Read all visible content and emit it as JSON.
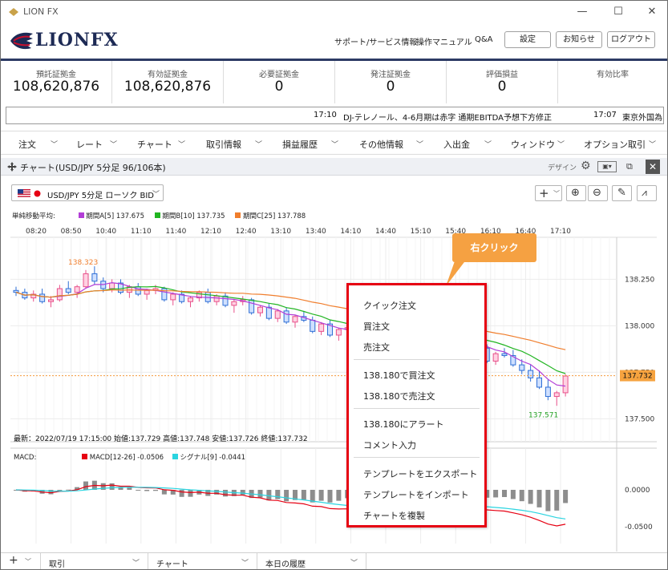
{
  "window": {
    "title": "LION FX",
    "minimize": "—",
    "maximize": "☐",
    "close": "✕"
  },
  "header": {
    "logo": "LIONFX",
    "links": [
      "サポート/サービス情報",
      "操作マニュアル",
      "Q&A"
    ],
    "buttons": [
      "設定",
      "お知らせ",
      "ログアウト"
    ]
  },
  "summary": [
    {
      "label": "預託証拠金",
      "value": "108,620,876"
    },
    {
      "label": "有効証拠金",
      "value": "108,620,876"
    },
    {
      "label": "必要証拠金",
      "value": "0"
    },
    {
      "label": "発注証拠金",
      "value": "0"
    },
    {
      "label": "評価損益",
      "value": "0"
    },
    {
      "label": "有効比率",
      "value": ""
    }
  ],
  "ticker": [
    {
      "time": "17:10",
      "text": "DJ-テレノール、4-6月期は赤字 通期EBITDA予想下方修正"
    },
    {
      "time": "17:07",
      "text": "東京外国為"
    }
  ],
  "menu": [
    "注文",
    "レート",
    "チャート",
    "取引情報",
    "損益履歴",
    "その他情報",
    "入出金",
    "ウィンドウ",
    "オプション取引"
  ],
  "panel": {
    "title": "チャート(USD/JPY 5分足 96/106本)",
    "design": "デザイン"
  },
  "symbol": {
    "label": "USD/JPY 5分足 ローソク BID",
    "flag": "us-flag",
    "dot": "jp-dot"
  },
  "legend": {
    "title": "単純移動平均:",
    "items": [
      {
        "label": "期間A[5] 137.675",
        "color": "#b23dd6"
      },
      {
        "label": "期間B[10] 137.735",
        "color": "#22b522"
      },
      {
        "label": "期間C[25] 137.788",
        "color": "#f07e2d"
      }
    ]
  },
  "status": "最新：2022/07/19 17:15:00 始値:137.729 高値:137.748 安値:137.726 終値:137.732",
  "macd_legend": {
    "title": "MACD:",
    "items": [
      {
        "label": "MACD[12-26] -0.0506",
        "color": "#e60012"
      },
      {
        "label": "シグナル[9] -0.0441",
        "color": "#2ad4e0"
      }
    ]
  },
  "context_menu": {
    "items": [
      "クイック注文",
      "買注文",
      "売注文",
      "138.180で買注文",
      "138.180で売注文",
      "138.180にアラート",
      "コメント入力",
      "テンプレートをエクスポート",
      "テンプレートをインポート",
      "チャートを複製"
    ]
  },
  "callout": "右クリック",
  "bottom_tabs": [
    "取引",
    "チャート",
    "本日の履歴"
  ],
  "chart_data": {
    "type": "candlestick",
    "time_labels": [
      "08:20",
      "08:50",
      "10:40",
      "11:10",
      "11:40",
      "12:10",
      "12:40",
      "13:10",
      "13:40",
      "14:10",
      "14:40",
      "15:10",
      "15:40",
      "16:10",
      "16:40",
      "17:10"
    ],
    "y_ticks": [
      138.25,
      138.0,
      137.75,
      137.5
    ],
    "y_tick_labels": [
      "138.250",
      "138.000",
      "137.750",
      "137.500"
    ],
    "ylim": [
      137.45,
      138.45
    ],
    "current_price": "137.732",
    "high_label": "138.323",
    "low_label": "137.571",
    "candles": [
      [
        138.19,
        138.21,
        138.16,
        138.18
      ],
      [
        138.18,
        138.2,
        138.14,
        138.15
      ],
      [
        138.15,
        138.19,
        138.13,
        138.17
      ],
      [
        138.17,
        138.2,
        138.12,
        138.13
      ],
      [
        138.13,
        138.16,
        138.1,
        138.14
      ],
      [
        138.14,
        138.22,
        138.13,
        138.2
      ],
      [
        138.2,
        138.24,
        138.17,
        138.18
      ],
      [
        138.18,
        138.22,
        138.15,
        138.21
      ],
      [
        138.21,
        138.3,
        138.2,
        138.28
      ],
      [
        138.28,
        138.32,
        138.22,
        138.24
      ],
      [
        138.24,
        138.26,
        138.18,
        138.2
      ],
      [
        138.2,
        138.25,
        138.18,
        138.23
      ],
      [
        138.23,
        138.25,
        138.17,
        138.18
      ],
      [
        138.18,
        138.22,
        138.15,
        138.21
      ],
      [
        138.21,
        138.23,
        138.16,
        138.17
      ],
      [
        138.17,
        138.2,
        138.14,
        138.19
      ],
      [
        138.19,
        138.22,
        138.17,
        138.2
      ],
      [
        138.2,
        138.21,
        138.13,
        138.14
      ],
      [
        138.14,
        138.18,
        138.11,
        138.17
      ],
      [
        138.17,
        138.19,
        138.12,
        138.13
      ],
      [
        138.13,
        138.16,
        138.1,
        138.15
      ],
      [
        138.15,
        138.19,
        138.13,
        138.18
      ],
      [
        138.18,
        138.2,
        138.12,
        138.13
      ],
      [
        138.13,
        138.17,
        138.11,
        138.16
      ],
      [
        138.16,
        138.18,
        138.1,
        138.11
      ],
      [
        138.11,
        138.14,
        138.07,
        138.13
      ],
      [
        138.13,
        138.16,
        138.11,
        138.14
      ],
      [
        138.14,
        138.15,
        138.06,
        138.07
      ],
      [
        138.07,
        138.11,
        138.05,
        138.1
      ],
      [
        138.1,
        138.12,
        138.03,
        138.04
      ],
      [
        138.04,
        138.09,
        138.02,
        138.08
      ],
      [
        138.08,
        138.1,
        138.01,
        138.02
      ],
      [
        138.02,
        138.06,
        137.99,
        138.05
      ],
      [
        138.05,
        138.08,
        138.02,
        138.03
      ],
      [
        138.03,
        138.05,
        137.96,
        137.97
      ],
      [
        137.97,
        138.02,
        137.95,
        138.01
      ],
      [
        138.01,
        138.03,
        137.94,
        137.95
      ],
      [
        137.95,
        137.99,
        137.92,
        137.98
      ],
      [
        137.98,
        138.01,
        137.96,
        137.99
      ],
      [
        137.99,
        138.02,
        137.96,
        137.97
      ],
      [
        137.97,
        138.0,
        137.95,
        137.99
      ],
      [
        137.99,
        138.03,
        137.97,
        138.02
      ],
      [
        138.02,
        138.05,
        137.98,
        137.99
      ],
      [
        137.99,
        138.01,
        137.96,
        138.0
      ],
      [
        138.0,
        138.02,
        137.97,
        137.98
      ],
      [
        137.98,
        138.0,
        137.94,
        137.96
      ],
      [
        137.96,
        138.0,
        137.94,
        137.99
      ],
      [
        137.99,
        138.01,
        137.96,
        137.97
      ],
      [
        137.97,
        137.99,
        137.9,
        137.91
      ],
      [
        137.91,
        137.96,
        137.89,
        137.95
      ],
      [
        137.95,
        137.98,
        137.93,
        137.94
      ],
      [
        137.94,
        137.96,
        137.88,
        137.89
      ],
      [
        137.89,
        137.93,
        137.86,
        137.92
      ],
      [
        137.92,
        137.95,
        137.87,
        137.88
      ],
      [
        137.88,
        137.9,
        137.8,
        137.81
      ],
      [
        137.81,
        137.86,
        137.79,
        137.85
      ],
      [
        137.85,
        137.88,
        137.83,
        137.84
      ],
      [
        137.84,
        137.87,
        137.78,
        137.79
      ],
      [
        137.79,
        137.82,
        137.74,
        137.76
      ],
      [
        137.76,
        137.79,
        137.7,
        137.72
      ],
      [
        137.72,
        137.76,
        137.66,
        137.67
      ],
      [
        137.67,
        137.71,
        137.6,
        137.62
      ],
      [
        137.62,
        137.65,
        137.57,
        137.64
      ],
      [
        137.64,
        137.74,
        137.62,
        137.73
      ]
    ]
  }
}
